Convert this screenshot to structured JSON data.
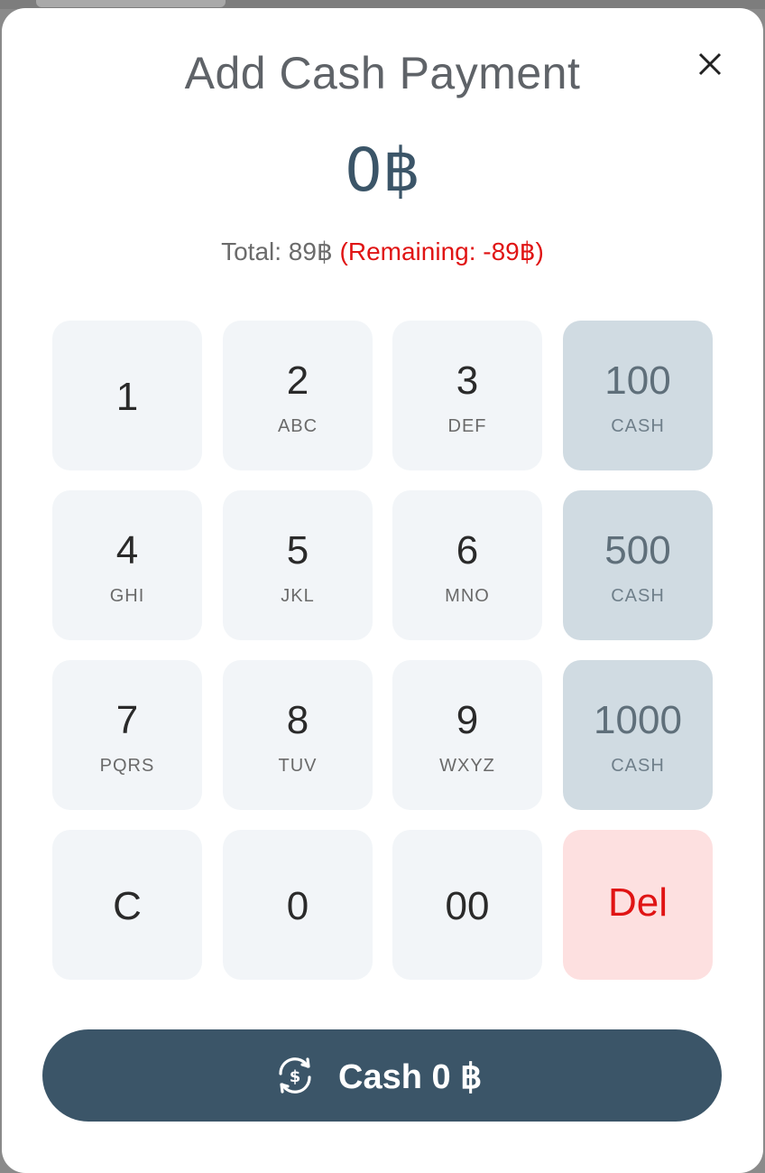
{
  "dialog": {
    "title": "Add Cash Payment",
    "close_icon": "close-icon"
  },
  "amount_display": "0฿",
  "summary": {
    "total": "Total: 89฿",
    "remaining": "(Remaining: -89฿)"
  },
  "keypad": {
    "k1": {
      "digit": "1",
      "letters": ""
    },
    "k2": {
      "digit": "2",
      "letters": "ABC"
    },
    "k3": {
      "digit": "3",
      "letters": "DEF"
    },
    "k100": {
      "digit": "100",
      "letters": "CASH"
    },
    "k4": {
      "digit": "4",
      "letters": "GHI"
    },
    "k5": {
      "digit": "5",
      "letters": "JKL"
    },
    "k6": {
      "digit": "6",
      "letters": "MNO"
    },
    "k500": {
      "digit": "500",
      "letters": "CASH"
    },
    "k7": {
      "digit": "7",
      "letters": "PQRS"
    },
    "k8": {
      "digit": "8",
      "letters": "TUV"
    },
    "k9": {
      "digit": "9",
      "letters": "WXYZ"
    },
    "k1000": {
      "digit": "1000",
      "letters": "CASH"
    },
    "kc": {
      "digit": "C"
    },
    "k0": {
      "digit": "0"
    },
    "k00": {
      "digit": "00"
    },
    "kdel": {
      "digit": "Del"
    }
  },
  "submit": {
    "label": "Cash 0 ฿",
    "icon": "cash-exchange-icon"
  },
  "colors": {
    "accent": "#3b5568",
    "remaining_red": "#e01414",
    "key_bg": "#f2f5f8",
    "cash_key_bg": "#d0dbe2",
    "del_key_bg": "#fde0e0"
  }
}
